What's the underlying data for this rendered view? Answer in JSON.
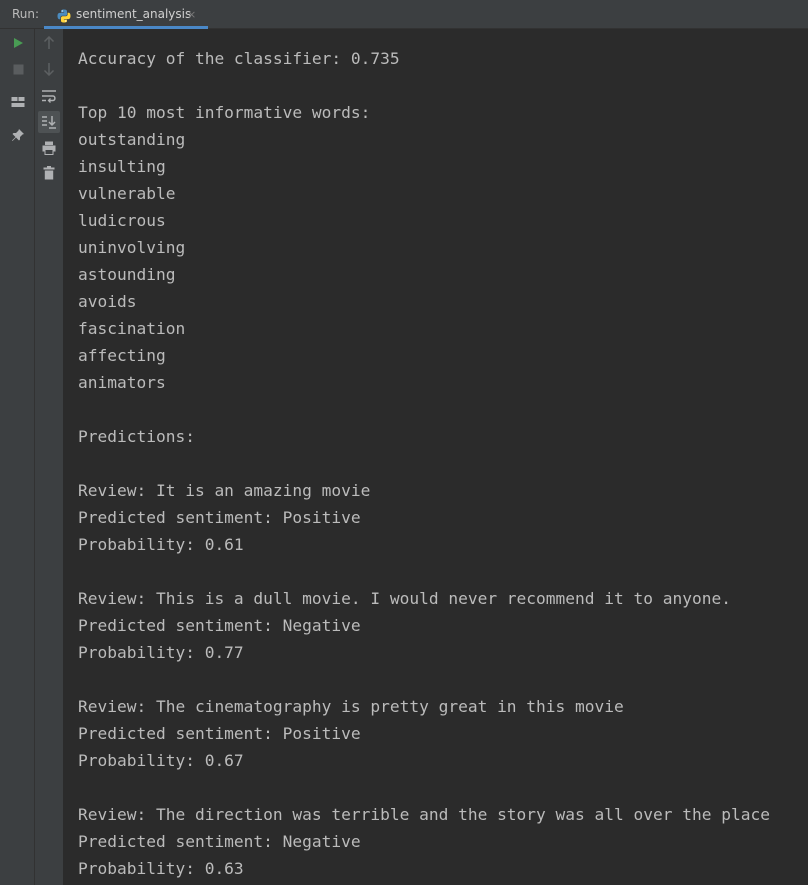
{
  "run_panel": {
    "run_label": "Run:",
    "tab": {
      "title": "sentiment_analysis",
      "close": "×",
      "icon": "python-icon"
    }
  },
  "toolbar": {
    "buttons": [
      {
        "name": "rerun-icon",
        "color": "#499c54"
      },
      {
        "name": "stop-icon",
        "color": "#5a5d5f"
      },
      {
        "name": "restore-layout-icon"
      },
      {
        "name": "pin-icon"
      }
    ],
    "secondary_buttons": [
      {
        "name": "up-arrow-icon"
      },
      {
        "name": "down-arrow-icon"
      },
      {
        "name": "soft-wrap-icon"
      },
      {
        "name": "scroll-to-end-icon",
        "active": true
      },
      {
        "name": "print-icon"
      },
      {
        "name": "trash-icon"
      }
    ]
  },
  "console": {
    "lines": [
      "Accuracy of the classifier: 0.735",
      "",
      "Top 10 most informative words:",
      "outstanding",
      "insulting",
      "vulnerable",
      "ludicrous",
      "uninvolving",
      "astounding",
      "avoids",
      "fascination",
      "affecting",
      "animators",
      "",
      "Predictions:",
      "",
      "Review: It is an amazing movie",
      "Predicted sentiment: Positive",
      "Probability: 0.61",
      "",
      "Review: This is a dull movie. I would never recommend it to anyone.",
      "Predicted sentiment: Negative",
      "Probability: 0.77",
      "",
      "Review: The cinematography is pretty great in this movie",
      "Predicted sentiment: Positive",
      "Probability: 0.67",
      "",
      "Review: The direction was terrible and the story was all over the place",
      "Predicted sentiment: Negative",
      "Probability: 0.63"
    ]
  }
}
